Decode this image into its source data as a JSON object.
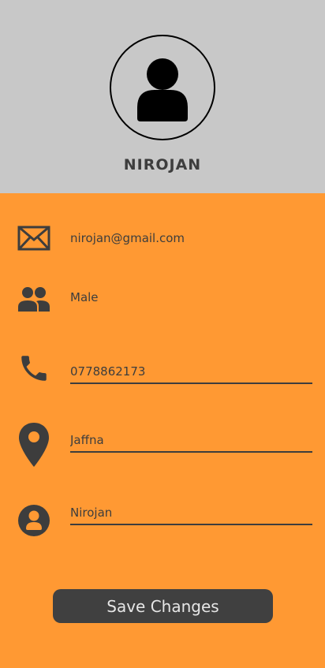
{
  "profile": {
    "name": "NIROJAN",
    "avatar_icon": "person-icon"
  },
  "details": {
    "email": "nirojan@gmail.com",
    "gender": "Male"
  },
  "form": {
    "phone_value": "0778862173",
    "location_value": "Jaffna",
    "username_value": "Nirojan"
  },
  "actions": {
    "save_label": "Save Changes"
  },
  "icons": {
    "email": "envelope-icon",
    "gender": "people-icon",
    "phone": "phone-icon",
    "location": "location-pin-icon",
    "username": "account-circle-icon"
  },
  "colors": {
    "header_bg": "#c8c8c8",
    "content_bg": "#ff9933",
    "text": "#3d3d3d",
    "button_bg": "#404040",
    "button_text": "#e6e6e6"
  }
}
